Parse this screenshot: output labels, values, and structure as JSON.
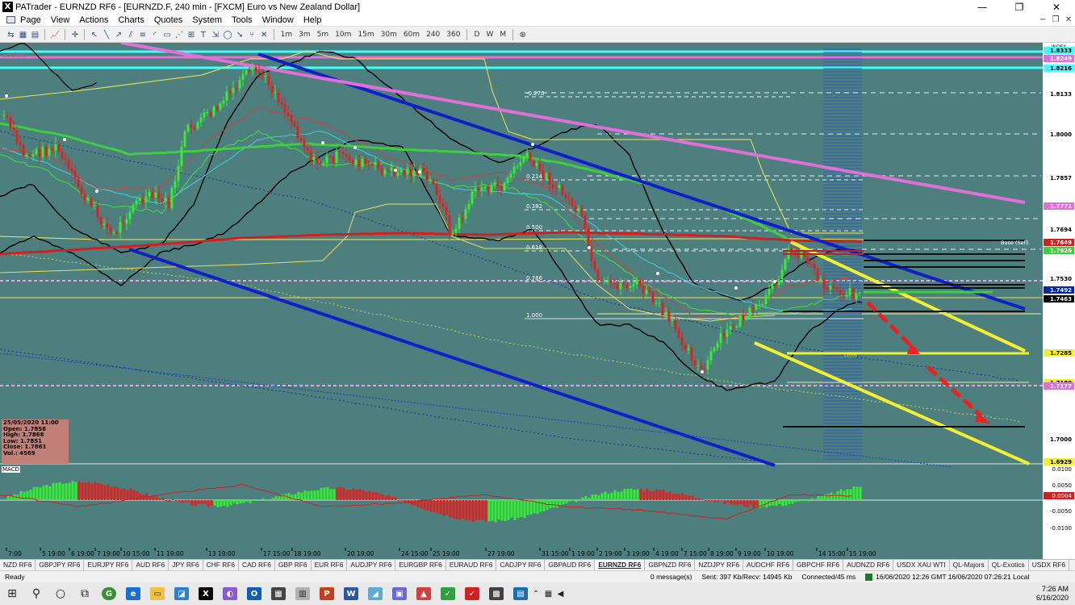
{
  "window": {
    "title": "PATrader - EURNZD RF6 - [EURNZD.F, 240 min - [FXCM] Euro vs New Zealand Dollar]",
    "minimize": "—",
    "maximize": "❐",
    "close": "✕"
  },
  "menu": {
    "items": [
      "Page",
      "View",
      "Actions",
      "Charts",
      "Quotes",
      "System",
      "Tools",
      "Window",
      "Help"
    ]
  },
  "toolbar": {
    "timeframes": [
      "1m",
      "3m",
      "5m",
      "10m",
      "15m",
      "30m",
      "60m",
      "240",
      "360"
    ],
    "periods": [
      "D",
      "W",
      "M"
    ]
  },
  "chart": {
    "watermark": "Locked",
    "price_axis_label": "INDEX",
    "price_labels": [
      "1.8333",
      "1.8249",
      "1.8216",
      "1.8133",
      "1.8000",
      "1.7857",
      "1.7771",
      "1.7694",
      "1.7649",
      "1.7626",
      "1.7530",
      "1.7492",
      "1.7463",
      "1.7285",
      "1.7180",
      "1.7177",
      "1.7000",
      "1.6929"
    ],
    "fib_labels": [
      "-0.270",
      "0.214",
      "0.382",
      "0.500",
      "0.618",
      "0.786",
      "1.000"
    ],
    "trade_labels": [
      "Base (Sell)",
      "Limit"
    ],
    "macd_labels": [
      "0.0100",
      "0.0050",
      "0.0004",
      "-0.0050",
      "-0.0100"
    ],
    "date_labels": [
      "7:00",
      "5 19:00",
      "6 19:00",
      "7 19:00",
      "10 15:00",
      "11 19:00",
      "13 19:00",
      "17 15:00",
      "18 19:00",
      "20 19:00",
      "24 15:00",
      "25 19:00",
      "27 19:00",
      "31 15:00",
      "1 19:00",
      "2 19:00",
      "3 19:00",
      "4 19:00",
      "7 15:00",
      "8 19:00",
      "9 19:00",
      "10 19:00",
      "14 15:00",
      "15 19:00"
    ]
  },
  "info_box": {
    "date": "25/05/2020 11:00",
    "open": "Open: 1.7858",
    "high": "High: 1.7868",
    "low": "Low: 1.7851",
    "close": "Close: 1.7861",
    "vol": "Vol.: 4569"
  },
  "macd_label": "MACD",
  "symbol_tabs": [
    {
      "label": "NZD RF6",
      "active": false
    },
    {
      "label": "GBPJPY RF6",
      "active": false
    },
    {
      "label": "EURJPY RF6",
      "active": false
    },
    {
      "label": "AUD RF6",
      "active": false
    },
    {
      "label": "JPY RF6",
      "active": false
    },
    {
      "label": "CHF RF6",
      "active": false
    },
    {
      "label": "CAD RF6",
      "active": false
    },
    {
      "label": "GBP RF6",
      "active": false
    },
    {
      "label": "EUR RF6",
      "active": false
    },
    {
      "label": "AUDJPY RF6",
      "active": false
    },
    {
      "label": "EURGBP RF6",
      "active": false
    },
    {
      "label": "EURAUD RF6",
      "active": false
    },
    {
      "label": "CADJPY RF6",
      "active": false
    },
    {
      "label": "GBPAUD RF6",
      "active": false
    },
    {
      "label": "EURNZD RF6",
      "active": true
    },
    {
      "label": "GBPNZD RF6",
      "active": false
    },
    {
      "label": "NZDJPY RF6",
      "active": false
    },
    {
      "label": "AUDCHF RF6",
      "active": false
    },
    {
      "label": "GBPCHF RF6",
      "active": false
    },
    {
      "label": "AUDNZD RF6",
      "active": false
    },
    {
      "label": "USDX XAU WTI",
      "active": false
    },
    {
      "label": "QL-Majors",
      "active": false
    },
    {
      "label": "QL-Exotics",
      "active": false
    },
    {
      "label": "USDX RF6",
      "active": false
    }
  ],
  "status": {
    "ready": "Ready",
    "messages": "0 message(s)",
    "traffic": "Sent: 397 Kb/Recv: 14945 Kb",
    "connection": "Connected/45 ms",
    "datetime": "16/06/2020 12:26 GMT  16/06/2020 07:26:21 Local"
  },
  "taskbar": {
    "time": "7:26 AM",
    "date": "6/16/2020"
  },
  "colors": {
    "chart_bg": "#4d7f7f",
    "bull": "#33ee33",
    "bear": "#dd2222",
    "channel": "#1020c8",
    "pink": "#e070d8",
    "yellow": "#f4ef30",
    "ema_green": "#3fce3f",
    "ema_red": "#d02020"
  }
}
